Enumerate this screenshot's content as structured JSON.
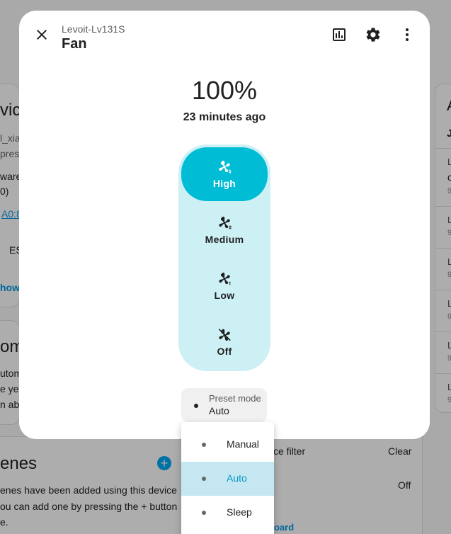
{
  "background": {
    "left_card": {
      "heading_fragment": "vice",
      "lines": [
        "l_xia",
        "press",
        "ware:",
        "0)"
      ],
      "link_fragment": "A0:8",
      "es_fragment": "ES",
      "show_fragment": "how"
    },
    "automations_card": {
      "heading_fragment": "om",
      "lines": [
        "utom",
        "e yet",
        "n abo"
      ]
    },
    "scenes_card": {
      "heading_fragment": "enes",
      "lines": [
        "enes have been added using this device",
        "ou can add one by pressing the + button",
        "e."
      ],
      "add_symbol": "+"
    },
    "controls_card": {
      "filter_label": "ce filter",
      "filter_value": "Clear",
      "row2_value": "Off",
      "link_fragment": "oard"
    },
    "right_card": {
      "heading_fragment": "A",
      "subheading_fragment": "J",
      "rows": [
        {
          "a": "L",
          "b": "c",
          "c": "9"
        },
        {
          "a": "L",
          "b": "9"
        },
        {
          "a": "L",
          "b": "9"
        },
        {
          "a": "L",
          "b": "9"
        },
        {
          "a": "L",
          "b": "9"
        },
        {
          "a": "L",
          "b": "9"
        }
      ]
    }
  },
  "dialog": {
    "subtitle": "Levoit-Lv131S",
    "title": "Fan",
    "state_value": "100%",
    "state_time": "23 minutes ago",
    "icons": {
      "close": "close-icon",
      "history": "chart-icon",
      "settings": "gear-icon",
      "more": "more-vert-icon"
    },
    "speeds": [
      {
        "label": "High",
        "icon": "fan-speed-3-icon",
        "active": true
      },
      {
        "label": "Medium",
        "icon": "fan-speed-2-icon",
        "active": false
      },
      {
        "label": "Low",
        "icon": "fan-speed-1-icon",
        "active": false
      },
      {
        "label": "Off",
        "icon": "fan-off-icon",
        "active": false
      }
    ],
    "preset": {
      "label": "Preset mode",
      "value": "Auto"
    }
  },
  "menu": {
    "options": [
      {
        "label": "Manual",
        "selected": false
      },
      {
        "label": "Auto",
        "selected": true
      },
      {
        "label": "Sleep",
        "selected": false
      }
    ]
  },
  "colors": {
    "accent": "#00bcd4",
    "speed_track": "#cdf0f4",
    "menu_selected": "#c5e7f2",
    "menu_selected_text": "#0997c4"
  }
}
